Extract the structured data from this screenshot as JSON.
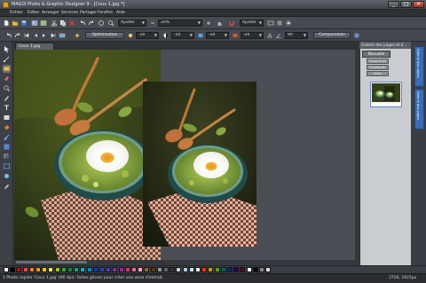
{
  "window": {
    "title": "MAGIX Photo & Graphic Designer 9 - [Couv 1.jpg *]",
    "buttons": [
      "_",
      "□",
      "×"
    ]
  },
  "menu": {
    "items": [
      "Fichier",
      "Éditer",
      "Arranger",
      "Services",
      "Partager",
      "Fenêtre",
      "Aide"
    ]
  },
  "toolbar1": {
    "zoom_mode": "Ajuster",
    "zoom_percent": "20%",
    "mode_select": "Ajuster"
  },
  "toolbar2": {
    "optimize_label": "Optimisation",
    "field1": "-20",
    "field2": "-20",
    "field3": "-20",
    "field4": "-20",
    "field5": "90",
    "compare_label": "Comparaison"
  },
  "document": {
    "tab_title": "Couv 1.jpg"
  },
  "right_panel": {
    "header": "Galerie des pages et d...",
    "new_page_label": "Nouvelle page",
    "btn_delete": "Supprimer",
    "btn_duplicate": "Dupliquer",
    "btn_info": "Infos"
  },
  "side_tabs": [
    "Galerie des objets",
    "Galerie des pages"
  ],
  "palette": {
    "colors": [
      "#ffffff",
      "#000000",
      "#cc0000",
      "#ee4444",
      "#ff7733",
      "#ff9900",
      "#ffcc00",
      "#ffee55",
      "#99cc00",
      "#33aa33",
      "#118833",
      "#00aa77",
      "#00bbbb",
      "#0088cc",
      "#0044aa",
      "#2244cc",
      "#5533bb",
      "#7733aa",
      "#aa2299",
      "#cc3377",
      "#ee6699",
      "#ffaacc",
      "#996633",
      "#663300",
      "#999999",
      "#666666",
      "#333333",
      "#cccccc",
      "#aaccee",
      "#ccddff",
      "#eeeeee",
      "#ff3300",
      "#cc9900",
      "#669900",
      "#006666",
      "#003366",
      "#330066",
      "#660033",
      "#ffffff",
      "#000000",
      "#888888",
      "#dddddd"
    ]
  },
  "status": {
    "message": "1 Photo copiée 'Couv 1.jpg' (96 dpi): Faites glisser pour créer une zone d'extrait.",
    "dimensions": "3726, 1925px"
  }
}
